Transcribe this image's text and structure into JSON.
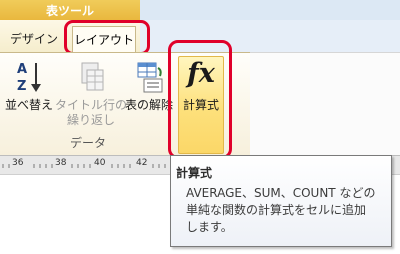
{
  "context_group": {
    "label": "表ツール"
  },
  "tabs": [
    {
      "label": "デザイン"
    },
    {
      "label": "レイアウト"
    }
  ],
  "ribbon": {
    "buttons": {
      "sort": {
        "label": "並べ替え",
        "icon": "sort-az-icon"
      },
      "repeat_header": {
        "label_line1": "タイトル行の",
        "label_line2": "繰り返し",
        "icon": "repeat-header-rows-icon",
        "disabled": true
      },
      "convert_to_text": {
        "label": "表の解除",
        "icon": "convert-to-text-icon"
      },
      "formula": {
        "label": "計算式",
        "glyph": "fx",
        "icon": "formula-fx-icon"
      }
    },
    "group_label": "データ"
  },
  "ruler": {
    "labels": [
      "36",
      "38",
      "40",
      "42",
      "44"
    ]
  },
  "tooltip": {
    "title": "計算式",
    "lines": [
      "AVERAGE、SUM、COUNT などの",
      "単純な関数の計算式をセルに追加",
      "します。"
    ]
  },
  "colors": {
    "context_accent": "#e9b83e",
    "highlight_red": "#e0002a",
    "active_button": "#fde07b"
  }
}
